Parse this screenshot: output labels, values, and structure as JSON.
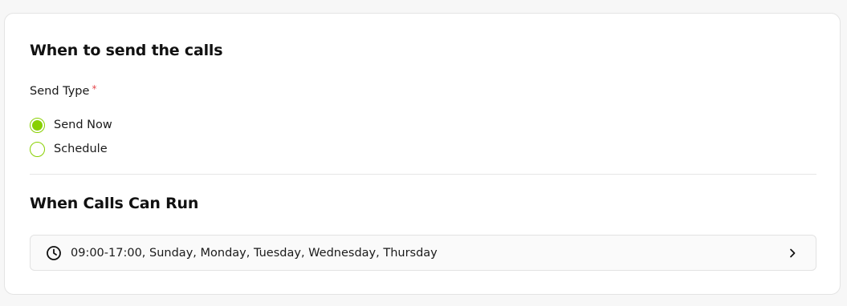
{
  "section1": {
    "title": "When to send the calls",
    "send_type_label": "Send Type",
    "required_marker": "*",
    "options": [
      {
        "label": "Send Now",
        "selected": true
      },
      {
        "label": "Schedule",
        "selected": false
      }
    ]
  },
  "section2": {
    "title": "When Calls Can Run",
    "schedule_summary": "09:00-17:00, Sunday, Monday, Tuesday, Wednesday, Thursday",
    "icons": [
      "clock-icon",
      "chevron-right-icon"
    ]
  },
  "colors": {
    "accent": "#88d000",
    "required": "#e5484d"
  }
}
